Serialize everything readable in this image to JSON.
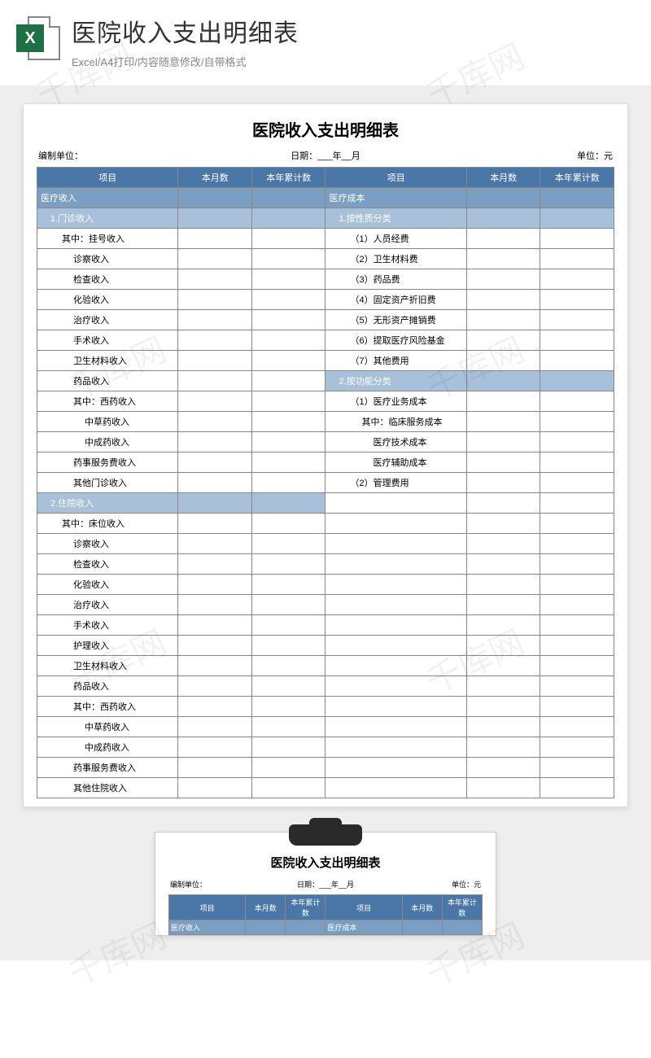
{
  "header": {
    "title": "医院收入支出明细表",
    "subtitle": "Excel/A4打印/内容随意修改/自带格式",
    "icon_letter": "X"
  },
  "doc": {
    "title": "医院收入支出明细表",
    "meta": {
      "org_label": "编制单位：",
      "date_label": "日期：___年__月",
      "unit_label": "单位：元"
    },
    "columns": {
      "item": "项目",
      "month": "本月数",
      "year": "本年累计数"
    },
    "left_rows": [
      {
        "text": "医疗收入",
        "cls": "sub-dark"
      },
      {
        "text": "1.门诊收入",
        "cls": "sub-light",
        "indent": "indent1"
      },
      {
        "text": "其中：挂号收入",
        "indent": "indent2"
      },
      {
        "text": "诊察收入",
        "indent": "indent3"
      },
      {
        "text": "检查收入",
        "indent": "indent3"
      },
      {
        "text": "化验收入",
        "indent": "indent3"
      },
      {
        "text": "治疗收入",
        "indent": "indent3"
      },
      {
        "text": "手术收入",
        "indent": "indent3"
      },
      {
        "text": "卫生材料收入",
        "indent": "indent3"
      },
      {
        "text": "药品收入",
        "indent": "indent3"
      },
      {
        "text": "其中：西药收入",
        "indent": "indent3"
      },
      {
        "text": "中草药收入",
        "indent": "indent4"
      },
      {
        "text": "中成药收入",
        "indent": "indent4"
      },
      {
        "text": "药事服务费收入",
        "indent": "indent3"
      },
      {
        "text": "其他门诊收入",
        "indent": "indent3"
      },
      {
        "text": "2.住院收入",
        "cls": "sub-light",
        "indent": "indent1"
      },
      {
        "text": "其中：床位收入",
        "indent": "indent2"
      },
      {
        "text": "诊察收入",
        "indent": "indent3"
      },
      {
        "text": "检查收入",
        "indent": "indent3"
      },
      {
        "text": "化验收入",
        "indent": "indent3"
      },
      {
        "text": "治疗收入",
        "indent": "indent3"
      },
      {
        "text": "手术收入",
        "indent": "indent3"
      },
      {
        "text": "护理收入",
        "indent": "indent3"
      },
      {
        "text": "卫生材料收入",
        "indent": "indent3"
      },
      {
        "text": "药品收入",
        "indent": "indent3"
      },
      {
        "text": "其中：西药收入",
        "indent": "indent3"
      },
      {
        "text": "中草药收入",
        "indent": "indent4"
      },
      {
        "text": "中成药收入",
        "indent": "indent4"
      },
      {
        "text": "药事服务费收入",
        "indent": "indent3"
      },
      {
        "text": "其他住院收入",
        "indent": "indent3"
      }
    ],
    "right_rows": [
      {
        "text": "医疗成本",
        "cls": "sub-dark"
      },
      {
        "text": "1.按性质分类",
        "cls": "sub-light",
        "indent": "indent1"
      },
      {
        "text": "（1）人员经费",
        "indent": "indent2"
      },
      {
        "text": "（2）卫生材料费",
        "indent": "indent2"
      },
      {
        "text": "（3）药品费",
        "indent": "indent2"
      },
      {
        "text": "（4）固定资产折旧费",
        "indent": "indent2"
      },
      {
        "text": "（5）无形资产摊销费",
        "indent": "indent2"
      },
      {
        "text": "（6）提取医疗风险基金",
        "indent": "indent2"
      },
      {
        "text": "（7）其他费用",
        "indent": "indent2"
      },
      {
        "text": "2.按功能分类",
        "cls": "sub-light",
        "indent": "indent1"
      },
      {
        "text": "（1）医疗业务成本",
        "indent": "indent2"
      },
      {
        "text": "其中：临床服务成本",
        "indent": "indent3"
      },
      {
        "text": "医疗技术成本",
        "indent": "indent4"
      },
      {
        "text": "医疗辅助成本",
        "indent": "indent4"
      },
      {
        "text": "（2）管理费用",
        "indent": "indent2"
      },
      {
        "text": ""
      },
      {
        "text": ""
      },
      {
        "text": ""
      },
      {
        "text": ""
      },
      {
        "text": ""
      },
      {
        "text": ""
      },
      {
        "text": ""
      },
      {
        "text": ""
      },
      {
        "text": ""
      },
      {
        "text": ""
      },
      {
        "text": ""
      },
      {
        "text": ""
      },
      {
        "text": ""
      },
      {
        "text": ""
      },
      {
        "text": ""
      }
    ]
  },
  "watermark_text": "千库网"
}
